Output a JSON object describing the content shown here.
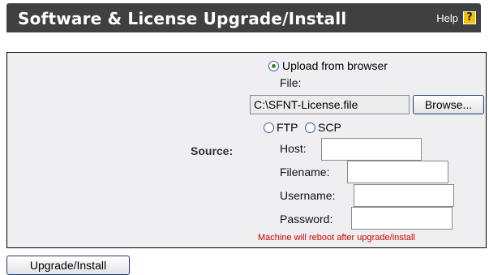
{
  "header": {
    "title": "Software & License Upgrade/Install",
    "help_label": "Help",
    "help_icon": "question-mark-icon",
    "help_glyph": "?",
    "background_color": "#404040",
    "help_icon_color": "#f2c200"
  },
  "form": {
    "source_label": "Source:",
    "upload_option": {
      "label": "Upload from browser",
      "selected": true
    },
    "file_label": "File:",
    "file_value": "C:\\SFNT-License.file",
    "browse_label": "Browse...",
    "ftp_option": {
      "label": "FTP",
      "selected": false
    },
    "scp_option": {
      "label": "SCP",
      "selected": false
    },
    "host_label": "Host:",
    "host_value": "",
    "filename_label": "Filename:",
    "filename_value": "",
    "username_label": "Username:",
    "username_value": "",
    "password_label": "Password:",
    "password_value": "",
    "warning_text": "Machine will reboot after upgrade/install",
    "warning_color": "#cc0000"
  },
  "actions": {
    "upgrade_label": "Upgrade/Install"
  }
}
